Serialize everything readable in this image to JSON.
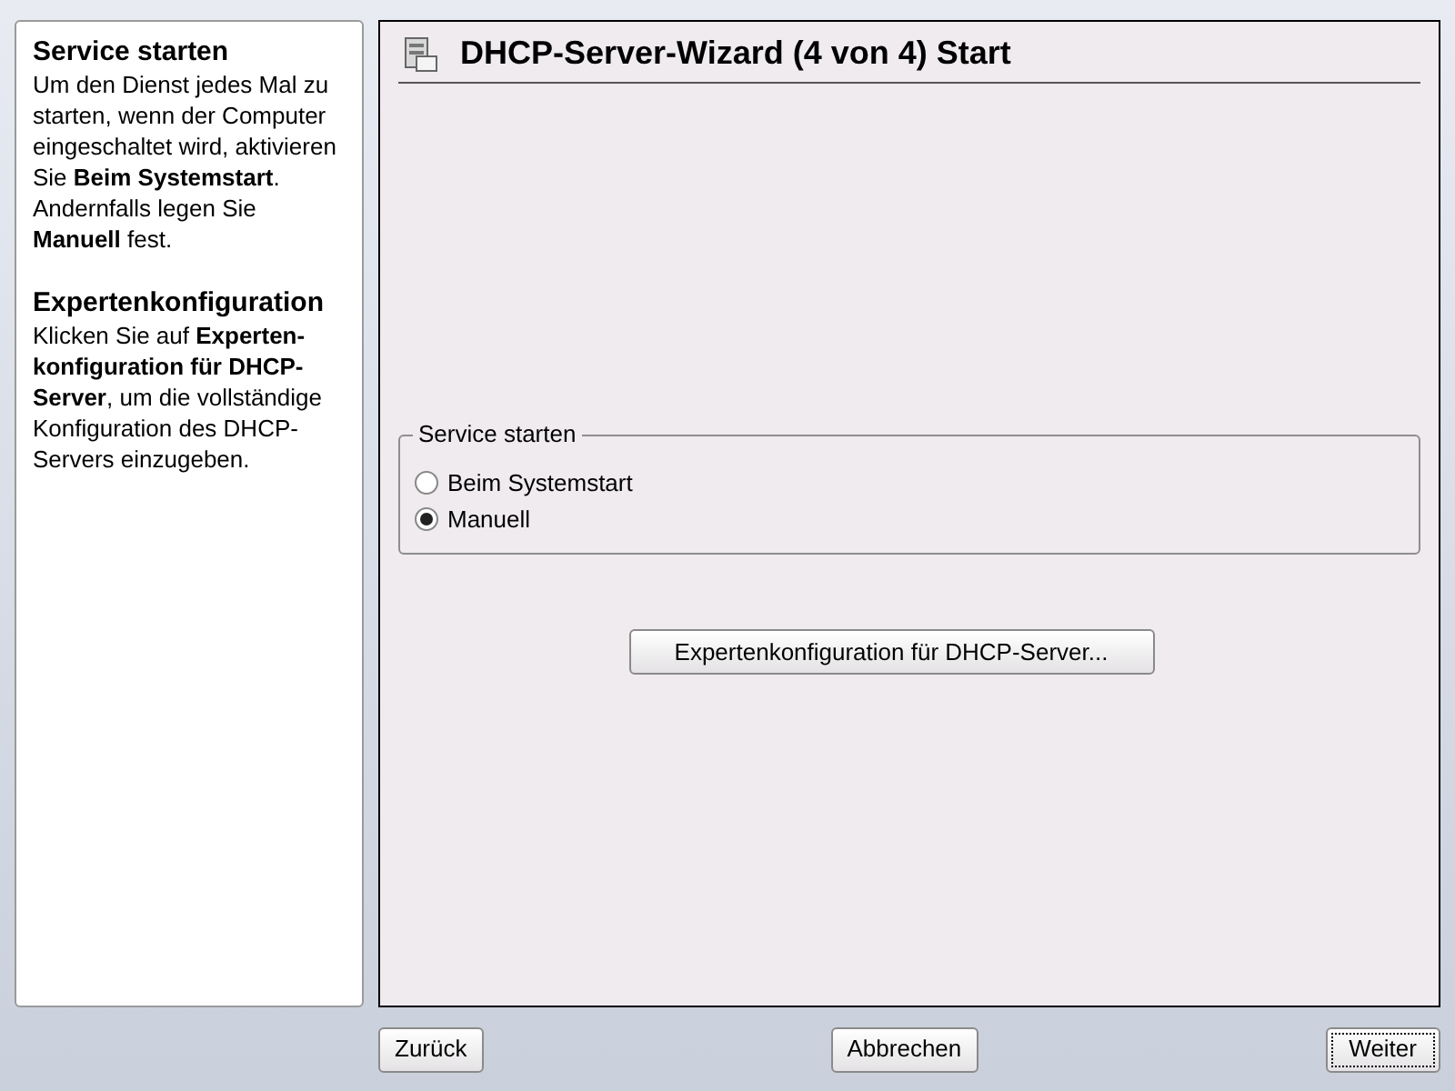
{
  "help": [
    {
      "heading": "Service starten",
      "text": "Um den Dienst jedes Mal zu starten, wenn der Computer eingeschaltet wird, aktivieren Sie **Beim Systemstart**. Andernfalls legen Sie **Manuell** fest."
    },
    {
      "heading": "Expertenkonfiguration",
      "text": "Klicken Sie auf **Experten-konfiguration für DHCP-Server**, um die vollständige Konfiguration des DHCP-Servers einzugeben."
    }
  ],
  "window": {
    "title": "DHCP-Server-Wizard (4 von 4) Start"
  },
  "group": {
    "label": "Service starten",
    "options": [
      {
        "label": "Beim Systemstart",
        "selected": false
      },
      {
        "label": "Manuell",
        "selected": true
      }
    ]
  },
  "expert_button": "Expertenkonfiguration für DHCP-Server...",
  "buttons": [
    {
      "label": "Zurück",
      "focused": false
    },
    {
      "label": "Abbrechen",
      "focused": false
    },
    {
      "label": "Weiter",
      "focused": true
    }
  ]
}
